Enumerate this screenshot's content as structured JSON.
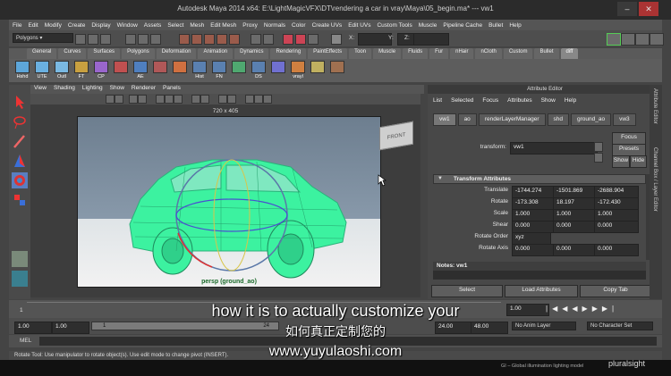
{
  "window": {
    "title": "Autodesk Maya 2014 x64: E:\\LightMagicVFX\\DT\\rendering a car in vray\\Maya\\05_begin.ma*   ---   vw1"
  },
  "menubar": [
    "File",
    "Edit",
    "Modify",
    "Create",
    "Display",
    "Window",
    "Assets",
    "Select",
    "Mesh",
    "Edit Mesh",
    "Proxy",
    "Normals",
    "Color",
    "Create UVs",
    "Edit UVs",
    "Custom Tools",
    "Muscle",
    "Pipeline Cache",
    "Bullet",
    "Help"
  ],
  "statusline": {
    "mode": "Polygons",
    "x_label": "X:",
    "y_label": "Y:",
    "z_label": "Z:"
  },
  "shelf_tabs": [
    "General",
    "Curves",
    "Surfaces",
    "Polygons",
    "Deformation",
    "Animation",
    "Dynamics",
    "Rendering",
    "PaintEffects",
    "Toon",
    "Muscle",
    "Fluids",
    "Fur",
    "nHair",
    "nCloth",
    "Custom",
    "Bullet",
    "diff"
  ],
  "shelf_active": "diff",
  "shelf_icons": [
    "Hshd",
    "UTE",
    "Outl",
    "FT",
    "CP",
    "",
    "AE",
    "",
    "",
    "Hist",
    "FN",
    "",
    "DS",
    "",
    "vrayl",
    "",
    ""
  ],
  "viewport": {
    "menu": [
      "View",
      "Shading",
      "Lighting",
      "Show",
      "Renderer",
      "Panels"
    ],
    "resolution": "720 x 405",
    "camera_label": "persp (ground_ao)",
    "cube_label": "FRONT"
  },
  "attribute_editor": {
    "title": "Attribute Editor",
    "menu": [
      "List",
      "Selected",
      "Focus",
      "Attributes",
      "Show",
      "Help"
    ],
    "tabs": [
      "vw1",
      "ao",
      "renderLayerManager",
      "shd",
      "ground_ao",
      "vw3"
    ],
    "active_tab": "vw1",
    "transform_label": "transform:",
    "transform_value": "vw1",
    "focus_button": "Focus",
    "presets_button": "Presets",
    "show_button": "Show",
    "hide_button": "Hide",
    "section": "Transform Attributes",
    "rows": [
      {
        "label": "Translate",
        "values": [
          "-1744.274",
          "-1501.869",
          "-2688.904"
        ]
      },
      {
        "label": "Rotate",
        "values": [
          "-173.308",
          "18.197",
          "-172.430"
        ]
      },
      {
        "label": "Scale",
        "values": [
          "1.000",
          "1.000",
          "1.000"
        ]
      },
      {
        "label": "Shear",
        "values": [
          "0.000",
          "0.000",
          "0.000"
        ]
      },
      {
        "label": "Rotate Order",
        "values": [
          "xyz"
        ]
      },
      {
        "label": "Rotate Axis",
        "values": [
          "0.000",
          "0.000",
          "0.000"
        ]
      }
    ],
    "notes_label": "Notes:  vw1",
    "select_button": "Select",
    "load_button": "Load Attributes",
    "copy_button": "Copy Tab",
    "side_tabs": [
      "Attribute Editor",
      "Channel Box / Layer Editor"
    ]
  },
  "timeline": {
    "start": "1",
    "current_frame": "1.00",
    "range_start": "1.00",
    "range_inner_start": "1.00",
    "range_marker": "1",
    "range_inner_end": "24",
    "range_end": "24.00",
    "range_max": "48.00",
    "anim_layer": "No Anim Layer",
    "character_set": "No Character Set"
  },
  "mel_label": "MEL",
  "help_text": "Rotate Tool: Use manipulator to rotate object(s). Use edit mode to change pivot (INSERT).",
  "subtitles": {
    "english": "how it is to actually customize your",
    "chinese": "如何真正定制您的",
    "url": "www.yuyulaoshi.com"
  },
  "watermark": "pluralsight",
  "footer_note": "GI – Global illumination lighting model",
  "colors": {
    "mesh": "#3cf2a0",
    "accent_tab": "#888888"
  }
}
